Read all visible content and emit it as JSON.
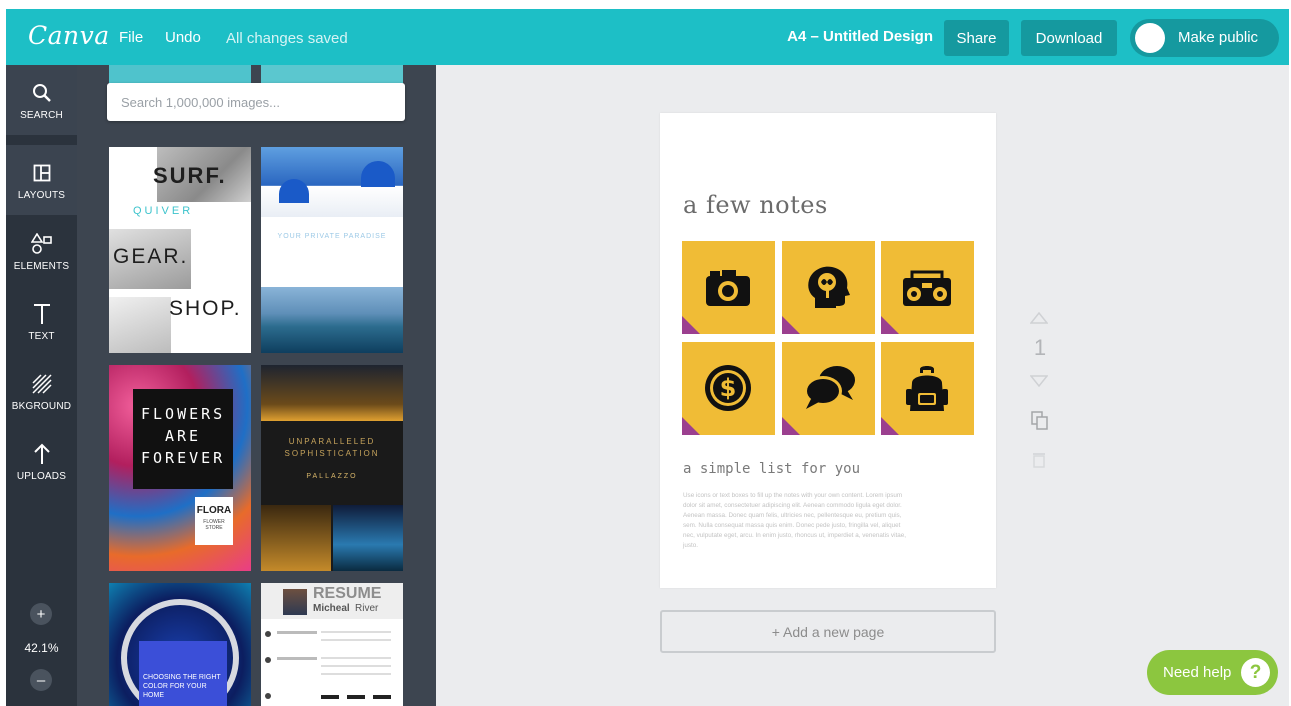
{
  "topbar": {
    "logo": "Canva",
    "file": "File",
    "undo": "Undo",
    "status": "All changes saved",
    "doc_title": "A4 – Untitled Design",
    "share": "Share",
    "download": "Download",
    "make_public": "Make public"
  },
  "sidenav": {
    "items": [
      {
        "label": "SEARCH",
        "icon": "search-icon"
      },
      {
        "label": "LAYOUTS",
        "icon": "layout-icon"
      },
      {
        "label": "ELEMENTS",
        "icon": "shapes-icon"
      },
      {
        "label": "TEXT",
        "icon": "text-icon"
      },
      {
        "label": "BKGROUND",
        "icon": "background-icon"
      },
      {
        "label": "UPLOADS",
        "icon": "upload-icon"
      }
    ],
    "zoom": "42.1%",
    "zoom_in": "+",
    "zoom_out": "–"
  },
  "panel": {
    "search_placeholder": "Search 1,000,000 images...",
    "templates": {
      "surf": {
        "line1": "SURF.",
        "line2": "QUIVER",
        "line3": "GEAR.",
        "line4": "SHOP."
      },
      "paradise": {
        "title": "YOUR PRIVATE PARADISE"
      },
      "flowers": {
        "title": "FLOWERS ARE FOREVER",
        "brand": "FLORA",
        "brand_sub": "FLOWER STORE"
      },
      "palazzo": {
        "title1": "UNPARALLELED",
        "title2": "SOPHISTICATION",
        "brand": "PALLAZZO"
      },
      "color": {
        "title": "CHOOSING THE RIGHT COLOR FOR YOUR HOME"
      },
      "resume": {
        "title": "RESUME",
        "first": "Micheal",
        "last": "River"
      }
    }
  },
  "page": {
    "title": "a few notes",
    "subtitle": "a simple list for you",
    "body": "Use icons or text boxes to fill up the notes with your own content. Lorem ipsum dolor sit amet, consectetuer adipiscing elit. Aenean commodo ligula eget dolor. Aenean massa. Donec quam felis, ultricies nec, pellentesque eu, pretium quis, sem. Nulla consequat massa quis enim. Donec pede justo, fringilla vel, aliquet nec, vulputate eget, arcu. In enim justo, rhoncus ut, imperdiet a, venenatis vitae, justo.",
    "notes": [
      "camera-icon",
      "brain-icon",
      "boombox-icon",
      "dollar-icon",
      "chat-icon",
      "backpack-icon"
    ],
    "number": "1"
  },
  "add_page": "+ Add a new page",
  "help": {
    "label": "Need help",
    "q": "?"
  },
  "colors": {
    "brand": "#1dbfc6",
    "note": "#f0bc36",
    "fold": "#9b3f8f",
    "help": "#8cc63f"
  }
}
